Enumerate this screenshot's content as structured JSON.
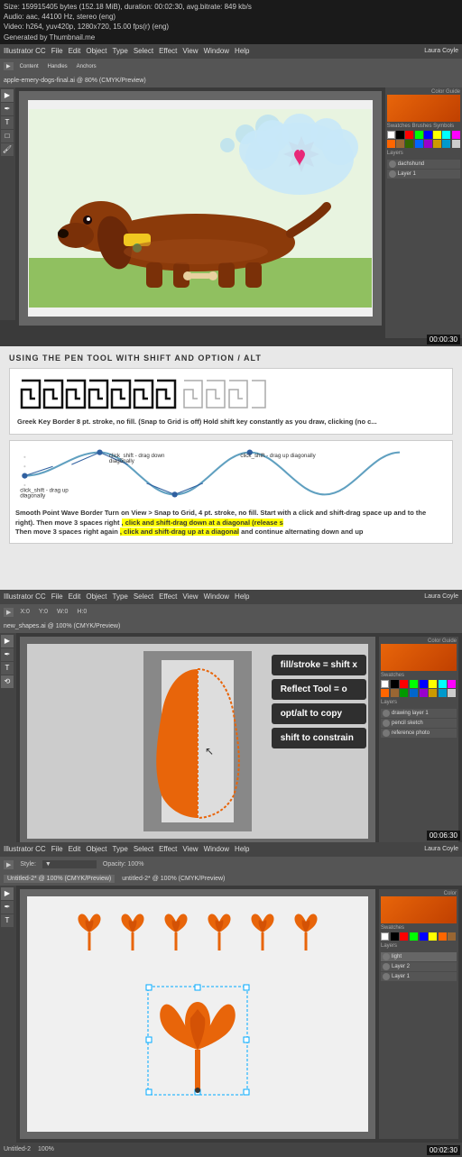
{
  "topBar": {
    "line1": "Size: 159915405 bytes (152.18 MiB), duration: 00:02:30, avg.bitrate: 849 kb/s",
    "line2": "Audio: aac, 44100 Hz, stereo (eng)",
    "line3": "Video: h264, yuv420p, 1280x720, 15.00 fps(r) (eng)",
    "line4": "Generated by Thumbnail.me"
  },
  "section1": {
    "menuItems": [
      "Illustrator CC",
      "File",
      "Edit",
      "Object",
      "Type",
      "Select",
      "Effect",
      "View",
      "Window",
      "Help"
    ],
    "userLabel": "Laura Coyle",
    "fileLabel": "apple-emery-dogs-final.ai @ 80% (CMYK/Preview)",
    "timer": "00:00:30"
  },
  "section2": {
    "title": "USING THE PEN TOOL WITH SHIFT AND OPTION / ALT",
    "greekKeyLabel": "Greek Key Border",
    "greekKeyDesc": "8 pt. stroke, no fill. (Snap to Grid is off) Hold shift key constantly as you draw, clicking (no c...",
    "waveLabel": "Smooth Point Wave Border",
    "waveDesc": "Turn on View > Snap to Grid, 4 pt. stroke, no fill. Start with a click and shift-drag",
    "waveDesc2": "space up and to the right). Then move 3 spaces right",
    "waveHighlight": ", click and shift-drag down at a diagonal (release s",
    "waveDesc3": "Then move 3 spaces right again",
    "waveHighlight2": ", click and shift-drag up at a diagonal",
    "waveDesc4": "and continue alternating down and up"
  },
  "section3": {
    "menuItems": [
      "Illustrator CC",
      "File",
      "Edit",
      "Object",
      "Type",
      "Select",
      "Effect",
      "View",
      "Window",
      "Help"
    ],
    "userLabel": "Laura Coyle",
    "fileLabel": "new_shapes.ai @ 100% (CMYK/Preview)",
    "infoBoxes": [
      {
        "label": "fill/stroke = shift x",
        "style": "dark"
      },
      {
        "label": "Reflect Tool = o",
        "style": "dark"
      },
      {
        "label": "opt/alt to copy",
        "style": "dark"
      },
      {
        "label": "shift to constrain",
        "style": "dark"
      }
    ],
    "timer": "00:06:30"
  },
  "section4": {
    "menuItems": [
      "Illustrator CC",
      "File",
      "Edit",
      "Object",
      "Type",
      "Select",
      "Effect",
      "View",
      "Window",
      "Help"
    ],
    "fileLabel1": "Untitled-2* @ 100% (CMYK/Preview)",
    "fileLabel2": "untitled-2* @ 100% (CMYK/Preview)",
    "timer": "00:02:30"
  },
  "colors": {
    "orange": "#E8650A",
    "darkBrown": "#5A2D0C",
    "tan": "#C8914A",
    "yellow": "#F0C020",
    "pink": "#E83878",
    "lightBlue": "#A0D0E8",
    "teal": "#40A080",
    "red": "#CC2020"
  },
  "swatches": [
    "#000000",
    "#333333",
    "#666666",
    "#999999",
    "#cccccc",
    "#ffffff",
    "#ff0000",
    "#cc0000",
    "#990000",
    "#ff6600",
    "#ff9900",
    "#ffcc00",
    "#ffff00",
    "#ccff00",
    "#99ff00",
    "#66ff00",
    "#00ff00",
    "#00cc00",
    "#009900",
    "#006600",
    "#00ff66",
    "#00ff99",
    "#00ffcc",
    "#00ffff",
    "#00ccff",
    "#0099ff",
    "#0066ff",
    "#0033ff",
    "#0000ff",
    "#3300ff",
    "#6600ff",
    "#9900ff",
    "#cc00ff",
    "#ff00ff",
    "#ff00cc",
    "#ff0099",
    "#ff0066",
    "#ff0033",
    "#cc3300",
    "#993300"
  ]
}
